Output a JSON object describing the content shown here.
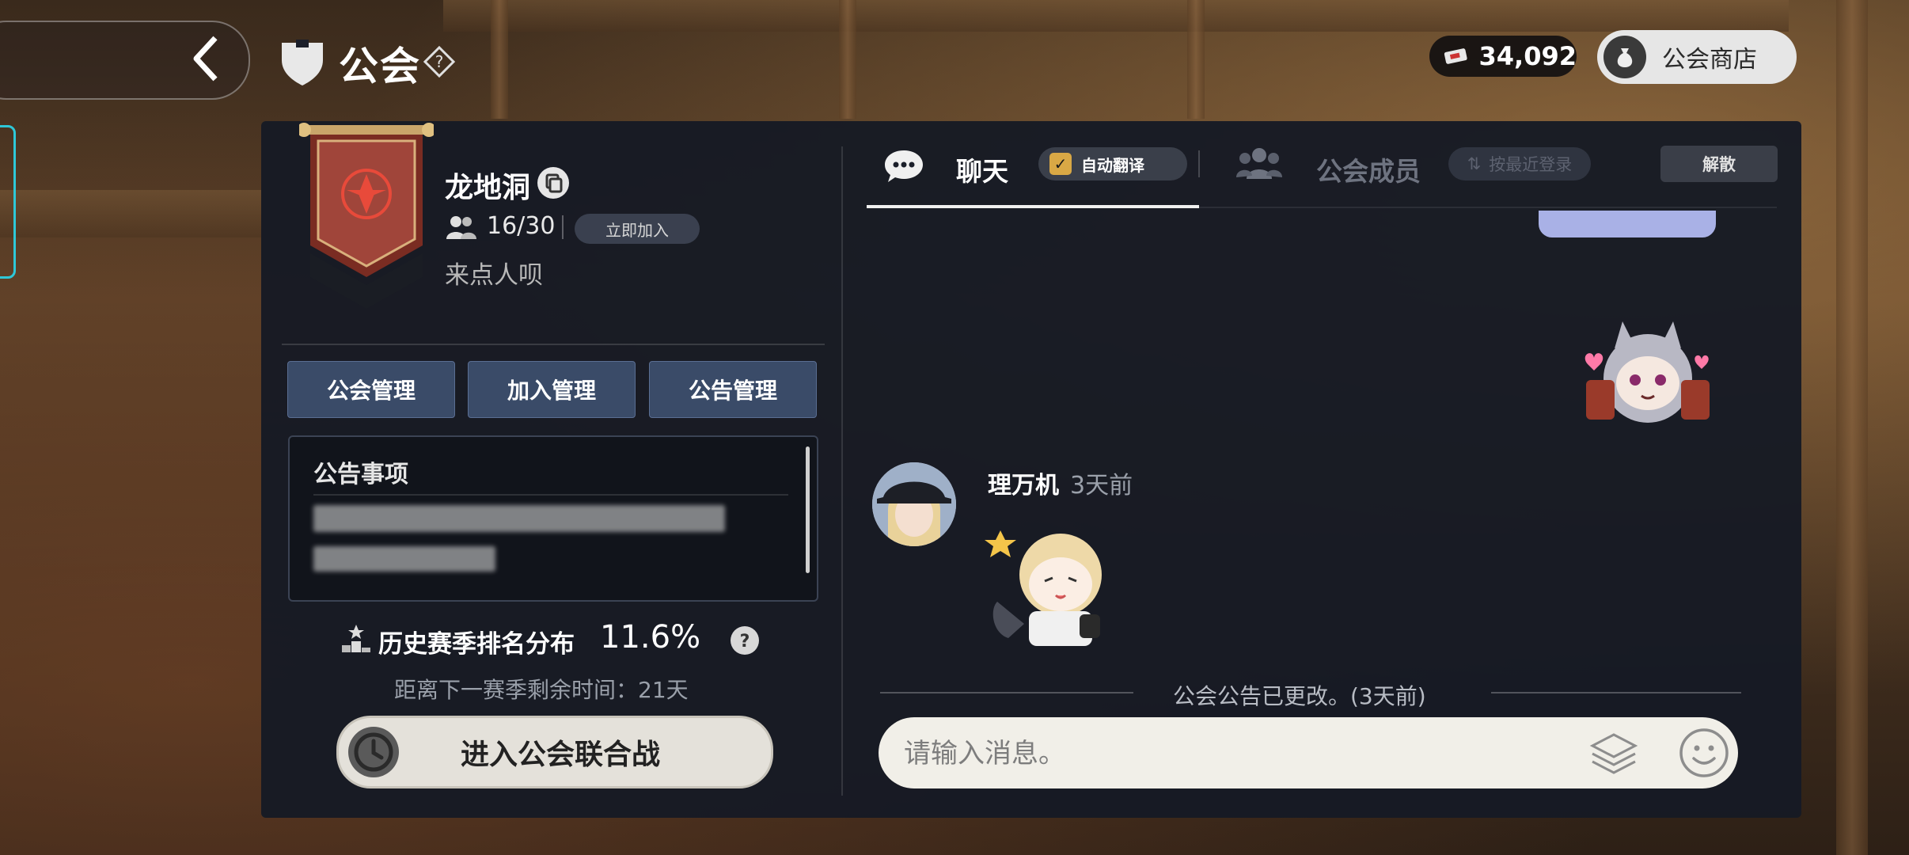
{
  "header": {
    "title": "公会",
    "currency_amount": "34,092",
    "shop_label": "公会商店"
  },
  "guild": {
    "name": "龙地洞",
    "member_count": "16/30",
    "join_label": "立即加入",
    "slogan": "来点人呗"
  },
  "management": {
    "guild_mgmt": "公会管理",
    "join_mgmt": "加入管理",
    "notice_mgmt": "公告管理"
  },
  "notice": {
    "title": "公告事项"
  },
  "season": {
    "rank_label": "历史赛季排名分布",
    "rank_value": "11.6%",
    "time_left": "距离下一赛季剩余时间：21天",
    "war_button": "进入公会联合战"
  },
  "tabs": {
    "chat": "聊天",
    "auto_translate": "自动翻译",
    "members": "公会成员",
    "sort": "按最近登录",
    "disband": "解散"
  },
  "chat": {
    "sender": "理万机",
    "sender_time": "3天前",
    "system_message": "公会公告已更改。(3天前)",
    "input_placeholder": "请输入消息。"
  }
}
